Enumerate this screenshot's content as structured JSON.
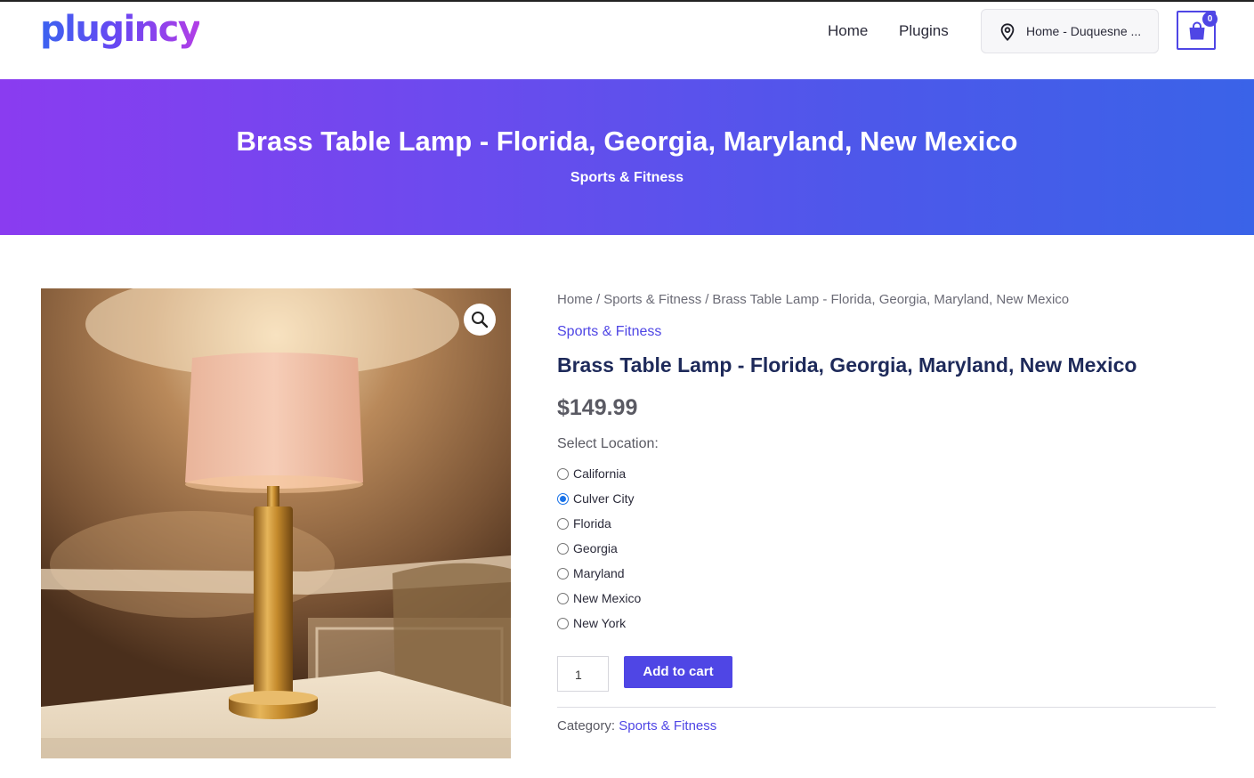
{
  "header": {
    "logo_text": "plugincy",
    "nav": [
      {
        "label": "Home"
      },
      {
        "label": "Plugins"
      }
    ],
    "location_selector": {
      "icon": "map-pin-icon",
      "text": "Home - Duquesne ..."
    },
    "cart": {
      "icon": "shopping-bag-icon",
      "count": "0"
    }
  },
  "hero": {
    "title": "Brass Table Lamp - Florida, Georgia, Maryland, New Mexico",
    "subtitle": "Sports & Fitness"
  },
  "product": {
    "image_alt": "Brass table lamp on a nightstand",
    "zoom_icon": "magnifier-icon",
    "breadcrumb": [
      "Home",
      "Sports & Fitness",
      "Brass Table Lamp - Florida, Georgia, Maryland, New Mexico"
    ],
    "breadcrumb_separator": "/",
    "category_link": "Sports & Fitness",
    "title": "Brass Table Lamp - Florida, Georgia, Maryland, New Mexico",
    "price": "$149.99",
    "location_label": "Select Location:",
    "locations": [
      {
        "label": "California",
        "checked": false
      },
      {
        "label": "Culver City",
        "checked": true
      },
      {
        "label": "Florida",
        "checked": false
      },
      {
        "label": "Georgia",
        "checked": false
      },
      {
        "label": "Maryland",
        "checked": false
      },
      {
        "label": "New Mexico",
        "checked": false
      },
      {
        "label": "New York",
        "checked": false
      }
    ],
    "quantity": "1",
    "add_to_cart_label": "Add to cart",
    "category_label": "Category:",
    "category_value": "Sports & Fitness"
  },
  "colors": {
    "accent": "#4f46e5",
    "hero_gradient_start": "#8a3cf0",
    "hero_gradient_end": "#3a63e8",
    "title": "#1e2a5a"
  }
}
